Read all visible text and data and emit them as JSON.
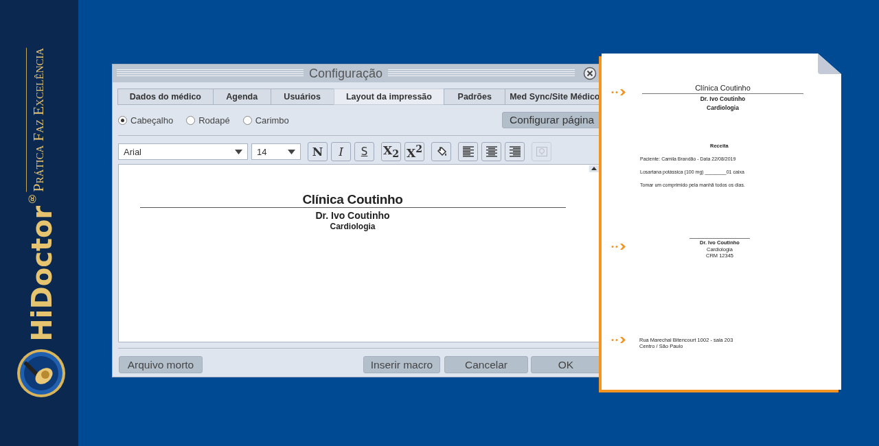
{
  "brand": {
    "name": "HiDoctor",
    "registered": "®",
    "tagline": "Prática Faz Excelência"
  },
  "dialog": {
    "title": "Configuração",
    "tabs": [
      {
        "label": "Dados do médico",
        "selected": false
      },
      {
        "label": "Agenda",
        "selected": false
      },
      {
        "label": "Usuários",
        "selected": false
      },
      {
        "label": "Layout da impressão",
        "selected": true
      },
      {
        "label": "Padrões",
        "selected": false
      },
      {
        "label": "Med Sync/Site Médico",
        "selected": false
      }
    ],
    "sections": [
      {
        "label": "Cabeçalho",
        "selected": true
      },
      {
        "label": "Rodapé",
        "selected": false
      },
      {
        "label": "Carimbo",
        "selected": false
      }
    ],
    "page_setup_button": "Configurar página",
    "font": {
      "value": "Arial"
    },
    "font_size": {
      "value": "14"
    },
    "toolbar": [
      {
        "kind": "bold",
        "label": "N",
        "disabled": false
      },
      {
        "kind": "italic",
        "label": "I",
        "disabled": false
      },
      {
        "kind": "underline",
        "label": "S",
        "disabled": false
      },
      {
        "kind": "subscript",
        "label": "X$_{2}$",
        "disabled": false
      },
      {
        "kind": "superscript",
        "label": "X$^{2}$",
        "disabled": false
      },
      {
        "kind": "fill",
        "disabled": false
      },
      {
        "kind": "align-left",
        "disabled": false
      },
      {
        "kind": "align-center",
        "disabled": false
      },
      {
        "kind": "align-right",
        "disabled": false
      },
      {
        "kind": "image",
        "disabled": true
      }
    ],
    "editor": {
      "title": "Clínica Coutinho",
      "lines": [
        "Dr. Ivo Coutinho",
        "Cardiologia"
      ]
    },
    "archive_button": "Arquivo morto",
    "buttons": [
      "Inserir macro",
      "Cancelar",
      "OK"
    ]
  },
  "preview": {
    "header": {
      "title": "Clínica Coutinho",
      "lines": [
        "Dr. Ivo Coutinho",
        "Cardiologia"
      ]
    },
    "heading": "Receita",
    "body": [
      "Paciente: Camila Brandão - Data 22/08/2019",
      "Losartana potássica (100 mg) ________01 caixa",
      "Tomar um comprimido pela manhã todos os dias."
    ],
    "signature": [
      "Dr. Ivo Coutinho",
      "Cardiologia",
      "CRM 12345"
    ],
    "footer": [
      "Rua Marechal Bitencourt 1002 - sala 203",
      "Centro / São Paulo"
    ]
  }
}
